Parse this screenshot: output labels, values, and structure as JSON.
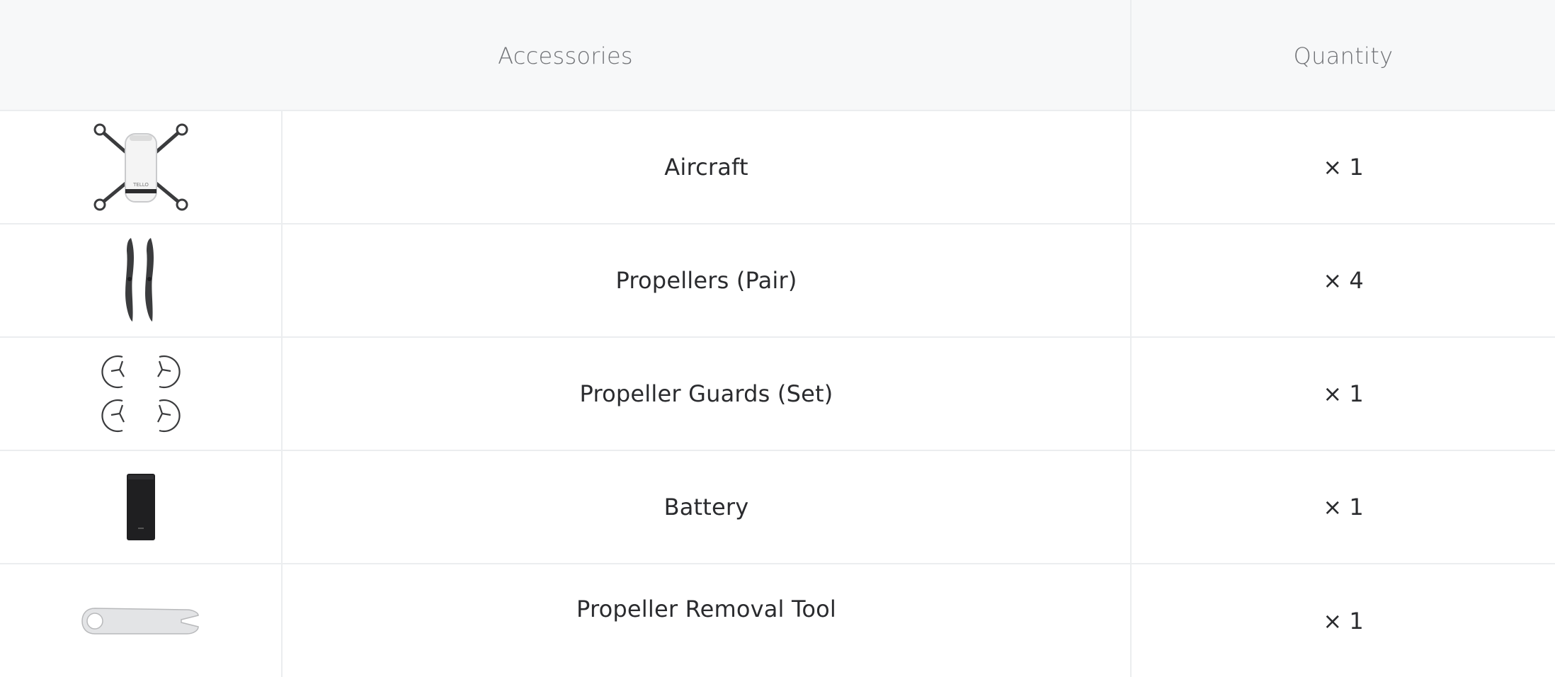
{
  "table": {
    "headers": {
      "accessories": "Accessories",
      "quantity": "Quantity"
    },
    "rows": [
      {
        "name": "Aircraft",
        "quantity": "× 1",
        "image": "drone-icon"
      },
      {
        "name": "Propellers (Pair)",
        "quantity": "× 4",
        "image": "propellers-icon"
      },
      {
        "name": "Propeller Guards (Set)",
        "quantity": "× 1",
        "image": "propeller-guards-icon"
      },
      {
        "name": "Battery",
        "quantity": "× 1",
        "image": "battery-icon"
      },
      {
        "name": "Propeller Removal Tool",
        "quantity": "× 1",
        "image": "removal-tool-icon"
      }
    ]
  }
}
